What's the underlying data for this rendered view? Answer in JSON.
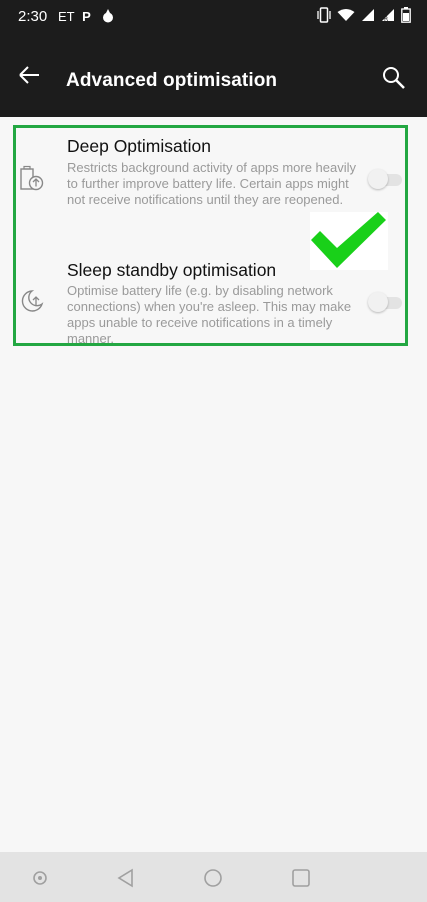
{
  "status_bar": {
    "time": "2:30",
    "carrier": "ET",
    "icons": [
      "p-icon",
      "drop-icon",
      "vibrate-icon",
      "wifi-icon",
      "signal-icon",
      "signal-r-icon",
      "battery-icon"
    ]
  },
  "app_bar": {
    "title": "Advanced optimisation",
    "back_icon": "back-arrow-icon",
    "search_icon": "search-icon"
  },
  "settings": [
    {
      "icon": "battery-upload-icon",
      "title": "Deep Optimisation",
      "summary": "Restricts background activity of apps more heavily to further improve battery life. Certain apps might not receive notifications until they are reopened.",
      "enabled": false
    },
    {
      "icon": "moon-up-icon",
      "title": "Sleep standby optimisation",
      "summary": "Optimise battery life (e.g. by disabling network connections) when you're asleep. This may make apps unable to receive notifications in a timely manner.",
      "enabled": false
    }
  ],
  "annotation": {
    "highlight_color": "#23a742",
    "check_color": "#19d019"
  },
  "nav_bar": {
    "icons": [
      "dot-icon",
      "back-triangle-icon",
      "home-circle-icon",
      "recents-square-icon"
    ]
  }
}
